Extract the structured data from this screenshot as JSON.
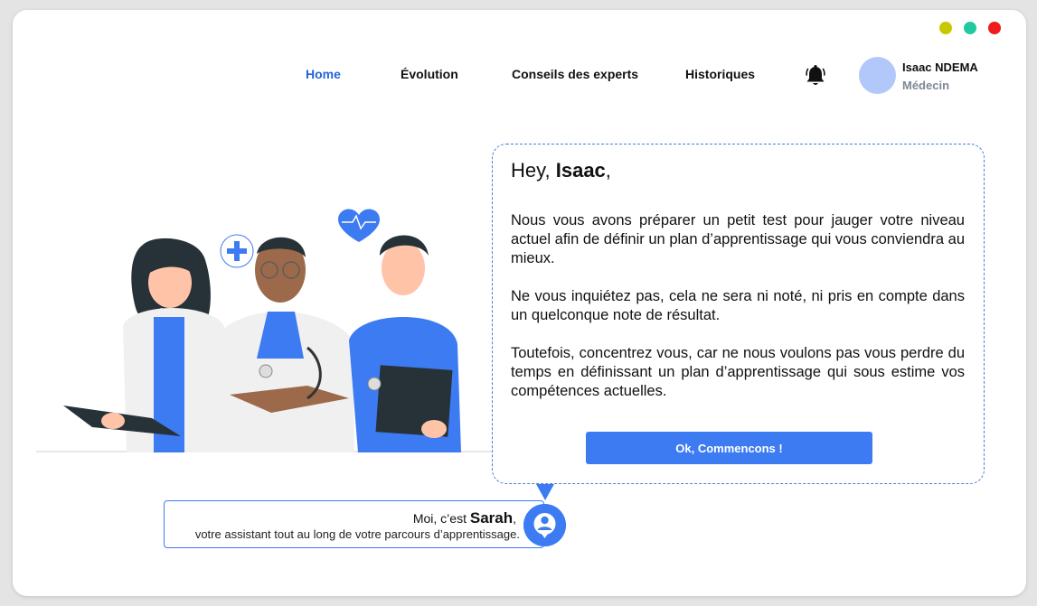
{
  "window": {
    "controls": [
      {
        "name": "minimize",
        "color": "#c8c800"
      },
      {
        "name": "maximize",
        "color": "#22c9a0"
      },
      {
        "name": "close",
        "color": "#ee1c1c"
      }
    ]
  },
  "nav": {
    "items": [
      {
        "label": "Home",
        "active": true
      },
      {
        "label": "Évolution",
        "active": false
      },
      {
        "label": "Conseils des experts",
        "active": false
      },
      {
        "label": "Historiques",
        "active": false
      }
    ],
    "accent": "#2563d8"
  },
  "user": {
    "name": "Isaac NDEMA",
    "role": "Médecin",
    "avatar_color": "#b3c8fa"
  },
  "welcome": {
    "greeting_prefix": "Hey,",
    "greeting_name": "Isaac",
    "greeting_suffix": ",",
    "paragraphs": [
      "Nous vous avons préparer un petit test pour jauger votre niveau actuel  afin de définir un plan d’apprentissage qui vous conviendra au mieux.",
      "Ne vous inquiétez pas, cela ne sera ni noté, ni pris en compte dans un quelconque note de résultat.",
      "Toutefois, concentrez vous, car ne nous voulons pas vous perdre du temps en définissant un plan d’apprentissage qui sous estime vos compétences actuelles."
    ],
    "cta_label": "Ok, Commencons !"
  },
  "assistant": {
    "intro": "Moi, c’est",
    "name": "Sarah",
    "name_suffix": ",",
    "tagline": "votre assistant tout au long de votre parcours d’apprentissage."
  },
  "colors": {
    "primary": "#3d7bf2",
    "bubble_border": "#4a7fd6"
  }
}
